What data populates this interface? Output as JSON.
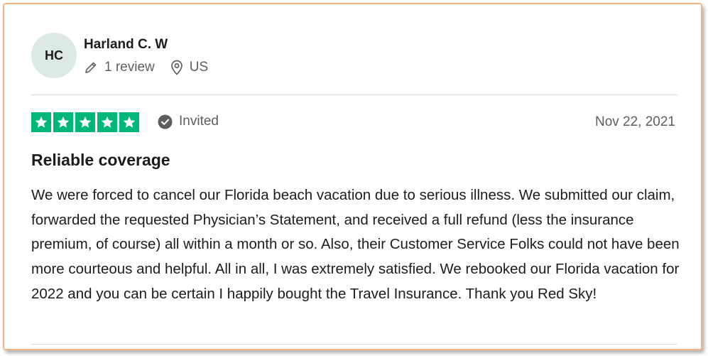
{
  "reviewer": {
    "initials": "HC",
    "name": "Harland C. W",
    "reviews_count": "1 review",
    "country": "US"
  },
  "review": {
    "rating": 5,
    "rating_max": 5,
    "verification": "Invited",
    "date": "Nov 22, 2021",
    "title": "Reliable coverage",
    "body": "We were forced to cancel our Florida beach vacation due to serious illness. We submitted our claim, forwarded the requested Physician’s Statement, and received a full refund (less the insurance premium, of course) all within a month or so. Also, their Customer Service Folks could not have been more courteous and helpful. All in all, I was extremely satisfied. We rebooked our Florida vacation for 2022 and you can be certain I happily bought the Travel Insurance. Thank you Red Sky!"
  },
  "icons": {
    "reviews": "pencil-icon",
    "location": "location-pin-icon",
    "verification": "check-circle-icon",
    "star": "star-icon"
  },
  "colors": {
    "star_background": "#00b67a",
    "avatar_background": "#dde9e6",
    "frame_border": "#f6b483",
    "muted_text": "#5e5e5e"
  }
}
